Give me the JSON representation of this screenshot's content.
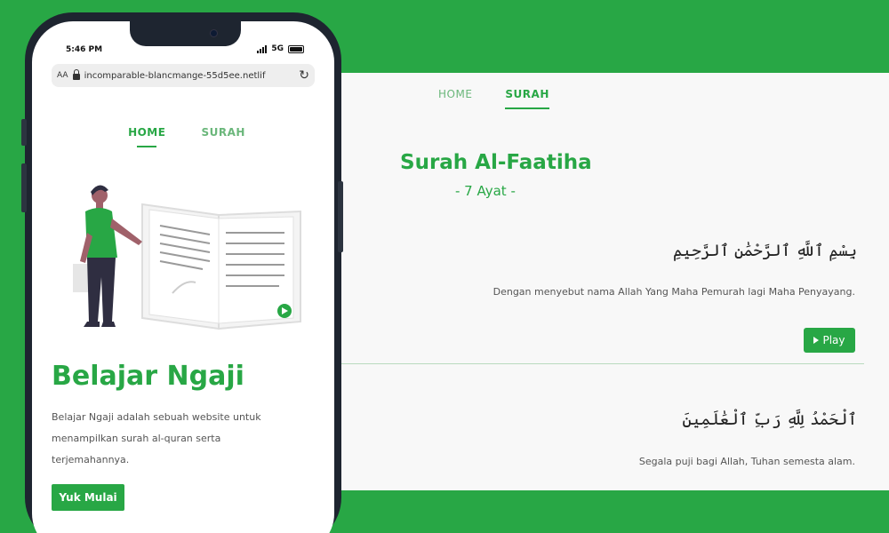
{
  "desktop": {
    "nav": [
      {
        "label": "HOME",
        "active": false
      },
      {
        "label": "SURAH",
        "active": true
      }
    ],
    "surah_title": "Surah Al-Faatiha",
    "surah_subtitle": "- 7 Ayat -",
    "ayat": [
      {
        "arabic": "بِسْمِ ٱللَّهِ ٱلرَّحْمَٰنِ ٱلرَّحِيمِ",
        "translation": "Dengan menyebut nama Allah Yang Maha Pemurah lagi Maha Penyayang.",
        "play_label": "Play"
      },
      {
        "arabic": "ٱلْحَمْدُ لِلَّهِ رَبِّ ٱلْعَٰلَمِينَ",
        "translation": "Segala puji bagi Allah, Tuhan semesta alam."
      }
    ]
  },
  "phone": {
    "status": {
      "time": "5:46 PM",
      "network": "5G"
    },
    "browser": {
      "text_size": "AA",
      "url": "incomparable-blancmange-55d5ee.netlif"
    },
    "nav": [
      {
        "label": "HOME",
        "active": true
      },
      {
        "label": "SURAH",
        "active": false
      }
    ],
    "hero_title": "Belajar Ngaji",
    "hero_description": "Belajar Ngaji adalah sebuah website untuk menampilkan surah al-quran serta terjemahannya.",
    "cta_label": "Yuk Mulai"
  },
  "colors": {
    "brand_green": "#28a745",
    "light_green": "#6bb77b"
  },
  "icons": [
    "lock-icon",
    "reload-icon",
    "play-icon",
    "signal-icon",
    "battery-icon"
  ]
}
